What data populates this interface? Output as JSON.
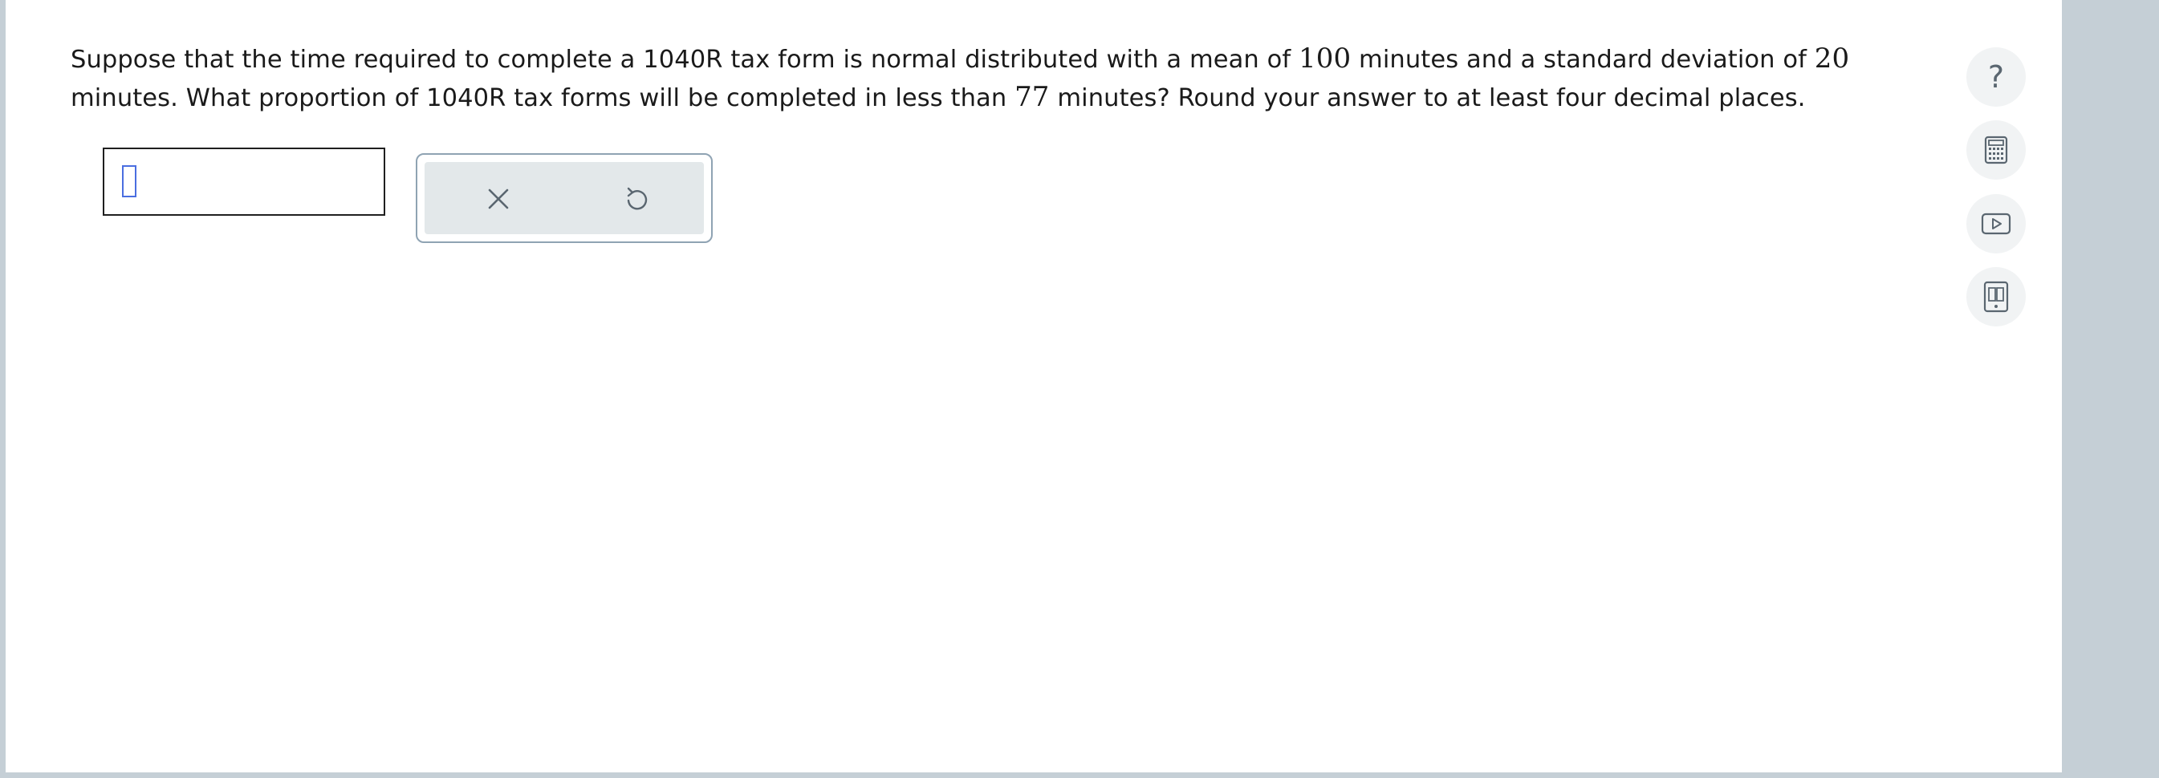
{
  "question": {
    "t1": "Suppose that the time required to complete a 1040R tax form is normal distributed with a mean of ",
    "mean": "100",
    "t2": " minutes and a standard deviation of ",
    "sd": "20",
    "t3": " minutes. What proportion of 1040R tax forms will be completed in less than ",
    "x": "77",
    "t4": " minutes? Round your answer to at least four decimal places."
  },
  "answer": {
    "value": ""
  },
  "actions": {
    "clear_icon": "close-icon",
    "undo_icon": "undo-icon"
  },
  "toolbar": {
    "help_glyph": "?",
    "icons": [
      "help-icon",
      "calculator-icon",
      "video-icon",
      "ebook-icon"
    ]
  },
  "colors": {
    "background": "#c5cfd6",
    "panel": "#ffffff",
    "cursor": "#4a6ee0",
    "action_bg": "#e3e8ea",
    "icon": "#5a6670"
  }
}
